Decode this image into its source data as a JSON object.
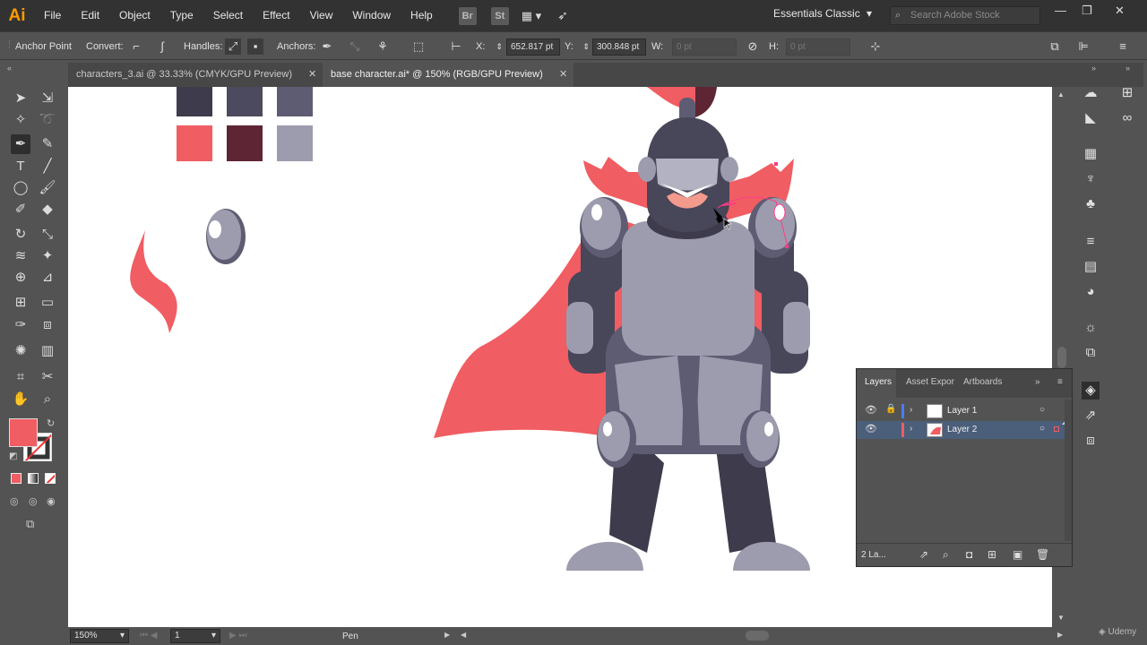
{
  "app": {
    "logo": "Ai",
    "brand_color": "#ff9a00"
  },
  "menu": [
    "File",
    "Edit",
    "Object",
    "Type",
    "Select",
    "Effect",
    "View",
    "Window",
    "Help"
  ],
  "menubar_icons": [
    "Br",
    "St"
  ],
  "workspace": "Essentials Classic",
  "search": {
    "placeholder": "Search Adobe Stock"
  },
  "control_bar": {
    "anchor_point": "Anchor Point",
    "convert": "Convert:",
    "handles": "Handles:",
    "anchors": "Anchors:",
    "x_label": "X:",
    "x_value": "652.817 pt",
    "y_label": "Y:",
    "y_value": "300.848 pt",
    "w_label": "W:",
    "w_value": "0 pt",
    "h_label": "H:",
    "h_value": "0 pt"
  },
  "tabs": [
    {
      "label": "characters_3.ai @ 33.33% (CMYK/GPU Preview)",
      "active": false
    },
    {
      "label": "base character.ai* @ 150% (RGB/GPU Preview)",
      "active": true
    }
  ],
  "fill_color": "#f05d62",
  "swatches": [
    "#3d3b4c",
    "#4c4a5e",
    "#5e5c72",
    "#f05d62",
    "#5e2535",
    "#9d9cae"
  ],
  "colors": {
    "cape": "#f05d62",
    "dark_armor": "#484659",
    "mid_armor": "#5e5c72",
    "light_armor": "#9d9cae",
    "visor": "#b3b2c2",
    "skin": "#f39a8d",
    "plume": "#5e2535"
  },
  "status": {
    "zoom": "150%",
    "artboard": "1",
    "tool": "Pen"
  },
  "layers_panel": {
    "tabs": [
      "Layers",
      "Asset Expor",
      "Artboards"
    ],
    "layers": [
      {
        "name": "Layer 1",
        "color": "#4a7cf5",
        "selected": false,
        "locked": true
      },
      {
        "name": "Layer 2",
        "color": "#f05d62",
        "selected": true,
        "locked": false
      }
    ],
    "count": "2 La..."
  },
  "watermark": "Udemy"
}
